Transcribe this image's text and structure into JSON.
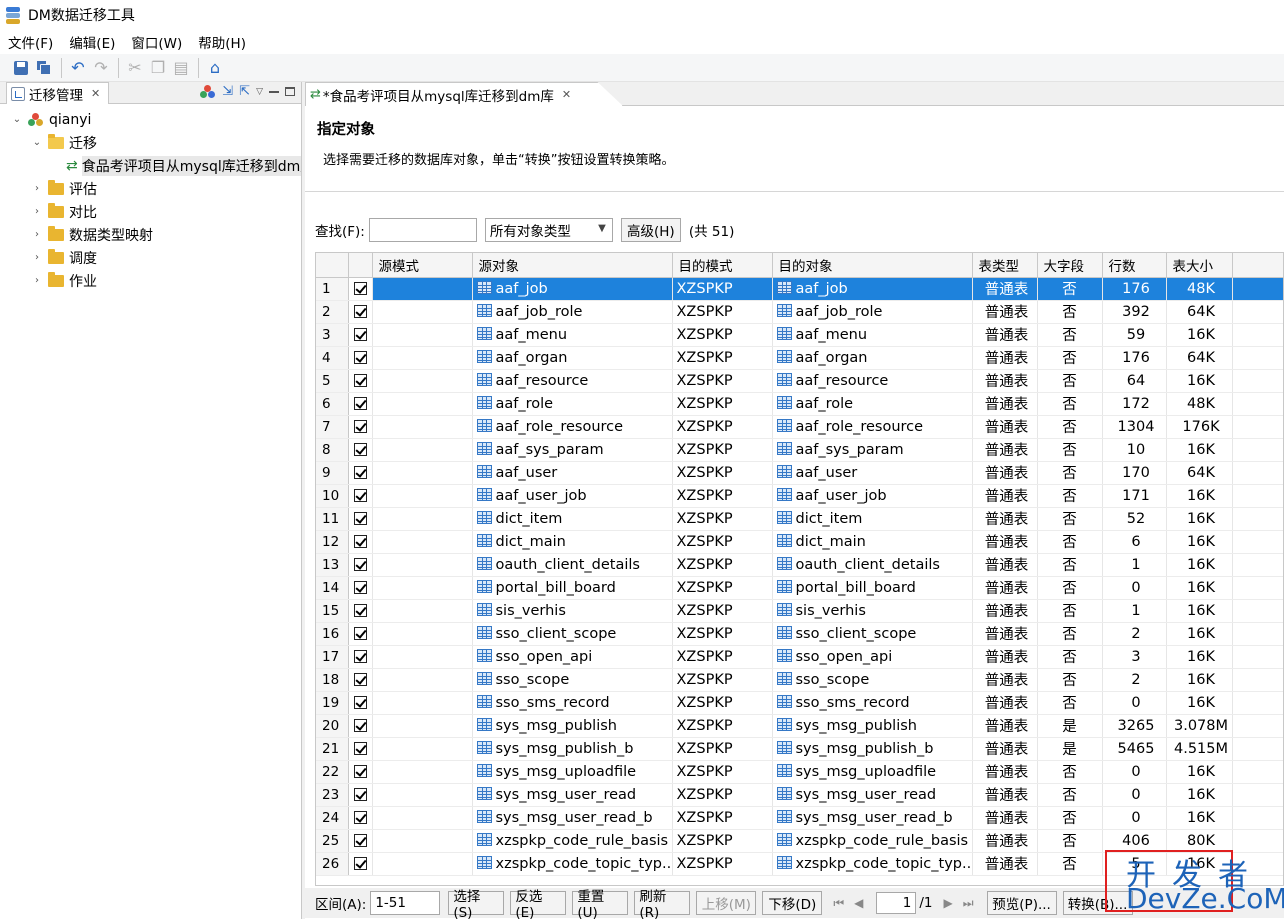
{
  "window": {
    "title": "DM数据迁移工具"
  },
  "menu": [
    "文件(F)",
    "编辑(E)",
    "窗口(W)",
    "帮助(H)"
  ],
  "icons": {
    "app": "database-stack-icon",
    "save": "save-icon",
    "save_all": "save-all-icon",
    "undo": "undo-icon",
    "redo": "redo-icon",
    "cut": "cut-icon",
    "copy": "copy-icon",
    "paste": "paste-icon",
    "home": "home-icon"
  },
  "left_panel": {
    "tab_label": "迁移管理",
    "tree": {
      "root": "qianyi",
      "migration_folder": "迁移",
      "migration_item": "食品考评项目从mysql库迁移到dm库",
      "folders": [
        "评估",
        "对比",
        "数据类型映射",
        "调度",
        "作业"
      ]
    }
  },
  "editor": {
    "tab_label": "*食品考评项目从mysql库迁移到dm库",
    "section_title": "指定对象",
    "description": "选择需要迁移的数据库对象，单击“转换”按钮设置转换策略。",
    "search_label": "查找(F):",
    "search_value": "",
    "type_filter": "所有对象类型",
    "advanced_button": "高级(H)",
    "count_label": "(共 51)"
  },
  "table": {
    "columns": [
      "",
      "",
      "源模式",
      "源对象",
      "目的模式",
      "目的对象",
      "表类型",
      "大字段",
      "行数",
      "表大小"
    ],
    "rows": [
      [
        "1",
        "",
        "aaf_job",
        "XZSPKP",
        "aaf_job",
        "普通表",
        "否",
        "176",
        "48K"
      ],
      [
        "2",
        "",
        "aaf_job_role",
        "XZSPKP",
        "aaf_job_role",
        "普通表",
        "否",
        "392",
        "64K"
      ],
      [
        "3",
        "",
        "aaf_menu",
        "XZSPKP",
        "aaf_menu",
        "普通表",
        "否",
        "59",
        "16K"
      ],
      [
        "4",
        "",
        "aaf_organ",
        "XZSPKP",
        "aaf_organ",
        "普通表",
        "否",
        "176",
        "64K"
      ],
      [
        "5",
        "",
        "aaf_resource",
        "XZSPKP",
        "aaf_resource",
        "普通表",
        "否",
        "64",
        "16K"
      ],
      [
        "6",
        "",
        "aaf_role",
        "XZSPKP",
        "aaf_role",
        "普通表",
        "否",
        "172",
        "48K"
      ],
      [
        "7",
        "",
        "aaf_role_resource",
        "XZSPKP",
        "aaf_role_resource",
        "普通表",
        "否",
        "1304",
        "176K"
      ],
      [
        "8",
        "",
        "aaf_sys_param",
        "XZSPKP",
        "aaf_sys_param",
        "普通表",
        "否",
        "10",
        "16K"
      ],
      [
        "9",
        "",
        "aaf_user",
        "XZSPKP",
        "aaf_user",
        "普通表",
        "否",
        "170",
        "64K"
      ],
      [
        "10",
        "",
        "aaf_user_job",
        "XZSPKP",
        "aaf_user_job",
        "普通表",
        "否",
        "171",
        "16K"
      ],
      [
        "11",
        "",
        "dict_item",
        "XZSPKP",
        "dict_item",
        "普通表",
        "否",
        "52",
        "16K"
      ],
      [
        "12",
        "",
        "dict_main",
        "XZSPKP",
        "dict_main",
        "普通表",
        "否",
        "6",
        "16K"
      ],
      [
        "13",
        "",
        "oauth_client_details",
        "XZSPKP",
        "oauth_client_details",
        "普通表",
        "否",
        "1",
        "16K"
      ],
      [
        "14",
        "",
        "portal_bill_board",
        "XZSPKP",
        "portal_bill_board",
        "普通表",
        "否",
        "0",
        "16K"
      ],
      [
        "15",
        "",
        "sis_verhis",
        "XZSPKP",
        "sis_verhis",
        "普通表",
        "否",
        "1",
        "16K"
      ],
      [
        "16",
        "",
        "sso_client_scope",
        "XZSPKP",
        "sso_client_scope",
        "普通表",
        "否",
        "2",
        "16K"
      ],
      [
        "17",
        "",
        "sso_open_api",
        "XZSPKP",
        "sso_open_api",
        "普通表",
        "否",
        "3",
        "16K"
      ],
      [
        "18",
        "",
        "sso_scope",
        "XZSPKP",
        "sso_scope",
        "普通表",
        "否",
        "2",
        "16K"
      ],
      [
        "19",
        "",
        "sso_sms_record",
        "XZSPKP",
        "sso_sms_record",
        "普通表",
        "否",
        "0",
        "16K"
      ],
      [
        "20",
        "",
        "sys_msg_publish",
        "XZSPKP",
        "sys_msg_publish",
        "普通表",
        "是",
        "3265",
        "3.078M"
      ],
      [
        "21",
        "",
        "sys_msg_publish_b",
        "XZSPKP",
        "sys_msg_publish_b",
        "普通表",
        "是",
        "5465",
        "4.515M"
      ],
      [
        "22",
        "",
        "sys_msg_uploadfile",
        "XZSPKP",
        "sys_msg_uploadfile",
        "普通表",
        "否",
        "0",
        "16K"
      ],
      [
        "23",
        "",
        "sys_msg_user_read",
        "XZSPKP",
        "sys_msg_user_read",
        "普通表",
        "否",
        "0",
        "16K"
      ],
      [
        "24",
        "",
        "sys_msg_user_read_b",
        "XZSPKP",
        "sys_msg_user_read_b",
        "普通表",
        "否",
        "0",
        "16K"
      ],
      [
        "25",
        "",
        "xzspkp_code_rule_basis",
        "XZSPKP",
        "xzspkp_code_rule_basis",
        "普通表",
        "否",
        "406",
        "80K"
      ],
      [
        "26",
        "",
        "xzspkp_code_topic_typ...",
        "XZSPKP",
        "xzspkp_code_topic_typ...",
        "普通表",
        "否",
        "5",
        "16K"
      ]
    ]
  },
  "bottom": {
    "range_label": "区间(A):",
    "range_value": "1-51",
    "buttons": [
      "选择(S)",
      "反选(E)",
      "重置(U)",
      "刷新(R)",
      "上移(M)",
      "下移(D)"
    ],
    "page_value": "1",
    "page_total": "/1",
    "preview_button": "预览(P)...",
    "convert_button": "转换(B)..."
  },
  "watermark": {
    "cn": "开发者",
    "en": "DevZe.CoM"
  },
  "colors": {
    "selection": "#1e82dc",
    "watermark_blue": "#1d63b8",
    "watermark_red": "#e02020"
  }
}
